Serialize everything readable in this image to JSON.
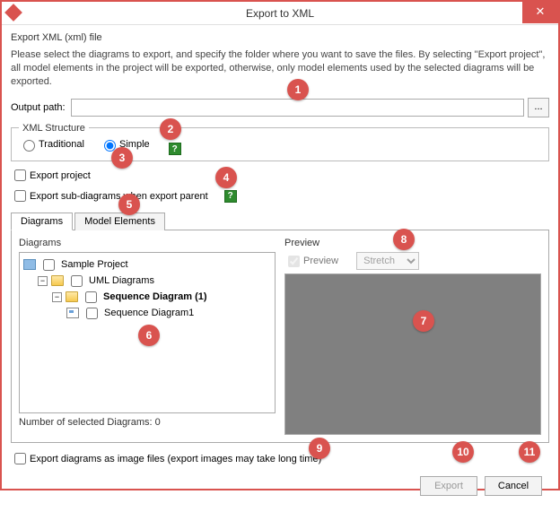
{
  "window": {
    "title": "Export to XML",
    "close": "✕"
  },
  "header": "Export XML (xml) file",
  "desc": "Please select the diagrams to export, and specify the folder where you want to save the files. By selecting \"Export project\", all model elements in the project will be exported, otherwise, only model elements used by the selected diagrams will be exported.",
  "outputPath": {
    "label": "Output path:",
    "value": "",
    "browse": "..."
  },
  "xmlStructure": {
    "legend": "XML Structure",
    "traditional": "Traditional",
    "simple": "Simple",
    "help": "?"
  },
  "exportProject": "Export project",
  "exportSub": "Export sub-diagrams when export parent",
  "tabs": {
    "diagrams": "Diagrams",
    "modelElements": "Model Elements"
  },
  "diagramsPanel": {
    "title": "Diagrams",
    "tree": {
      "root": "Sample Project",
      "uml": "UML Diagrams",
      "seq1": "Sequence Diagram (1)",
      "seq2": "Sequence Diagram1"
    },
    "selCountLabel": "Number of selected Diagrams: 0"
  },
  "previewPanel": {
    "title": "Preview",
    "chkLabel": "Preview",
    "mode": "Stretch"
  },
  "exportImages": "Export diagrams as image files (export images may take long time)",
  "buttons": {
    "export": "Export",
    "cancel": "Cancel"
  },
  "badges": {
    "b1": "1",
    "b2": "2",
    "b3": "3",
    "b4": "4",
    "b5": "5",
    "b6": "6",
    "b7": "7",
    "b8": "8",
    "b9": "9",
    "b10": "10",
    "b11": "11"
  }
}
